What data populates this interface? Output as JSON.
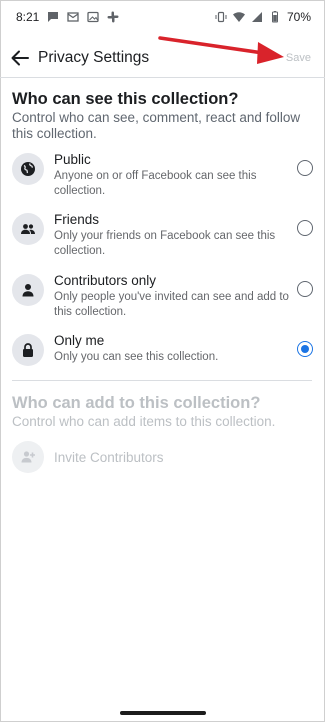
{
  "status_bar": {
    "time": "8:21",
    "battery": "70%",
    "left_icons": [
      "message-icon",
      "email-icon",
      "photo-icon",
      "slack-icon"
    ],
    "right_icons": [
      "vibrate-icon",
      "wifi-icon",
      "signal-icon",
      "battery-icon"
    ]
  },
  "app_bar": {
    "title": "Privacy Settings",
    "save_label": "Save"
  },
  "visibility": {
    "title": "Who can see this collection?",
    "description": "Control who can see, comment, react and follow this collection.",
    "options": [
      {
        "icon": "globe-icon",
        "label": "Public",
        "sub": "Anyone on or off Facebook can see this collection.",
        "selected": false
      },
      {
        "icon": "friends-icon",
        "label": "Friends",
        "sub": "Only your friends on Facebook can see this collection.",
        "selected": false
      },
      {
        "icon": "person-icon",
        "label": "Contributors only",
        "sub": "Only people you've invited can see and add to this collection.",
        "selected": false
      },
      {
        "icon": "lock-icon",
        "label": "Only me",
        "sub": "Only you can see this collection.",
        "selected": true
      }
    ]
  },
  "contributors": {
    "title": "Who can add to this collection?",
    "description": "Control who can add items to this collection.",
    "invite_label": "Invite Contributors"
  },
  "colors": {
    "accent": "#1b74e4",
    "annotation": "#d9232b",
    "disabled": "#bcc0c4"
  }
}
